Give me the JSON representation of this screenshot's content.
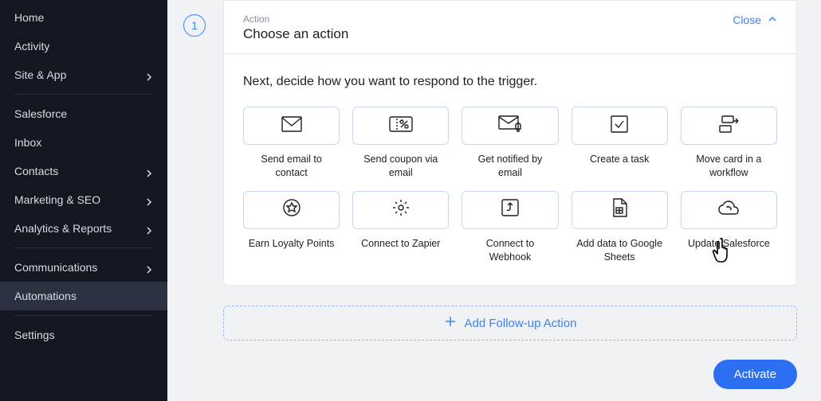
{
  "sidebar": {
    "items1": [
      {
        "label": "Home",
        "expand": false
      },
      {
        "label": "Activity",
        "expand": false
      },
      {
        "label": "Site & App",
        "expand": true
      }
    ],
    "items2": [
      {
        "label": "Salesforce",
        "expand": false
      },
      {
        "label": "Inbox",
        "expand": false
      },
      {
        "label": "Contacts",
        "expand": true
      },
      {
        "label": "Marketing & SEO",
        "expand": true
      },
      {
        "label": "Analytics & Reports",
        "expand": true
      }
    ],
    "items3": [
      {
        "label": "Communications",
        "expand": true
      },
      {
        "label": "Automations",
        "expand": false,
        "active": true
      }
    ],
    "items4": [
      {
        "label": "Settings",
        "expand": false
      }
    ]
  },
  "step": {
    "number": "1"
  },
  "header": {
    "eyebrow": "Action",
    "title": "Choose an action",
    "close": "Close"
  },
  "body": {
    "instruction": "Next, decide how you want to respond to the trigger."
  },
  "actions": [
    {
      "id": "send-email",
      "label": "Send email to contact",
      "icon": "mail"
    },
    {
      "id": "send-coupon",
      "label": "Send coupon via email",
      "icon": "coupon"
    },
    {
      "id": "get-notified",
      "label": "Get notified by email",
      "icon": "mail-bell"
    },
    {
      "id": "create-task",
      "label": "Create a task",
      "icon": "check"
    },
    {
      "id": "move-card",
      "label": "Move card in a workflow",
      "icon": "cards"
    },
    {
      "id": "earn-loyalty",
      "label": "Earn Loyalty Points",
      "icon": "star-circle"
    },
    {
      "id": "connect-zapier",
      "label": "Connect to Zapier",
      "icon": "gear"
    },
    {
      "id": "connect-webhook",
      "label": "Connect to Webhook",
      "icon": "hook"
    },
    {
      "id": "google-sheets",
      "label": "Add data to Google Sheets",
      "icon": "sheets"
    },
    {
      "id": "update-salesforce",
      "label": "Update Salesforce",
      "icon": "cloud"
    }
  ],
  "followup": {
    "label": "Add Follow-up Action"
  },
  "activate": {
    "label": "Activate"
  }
}
